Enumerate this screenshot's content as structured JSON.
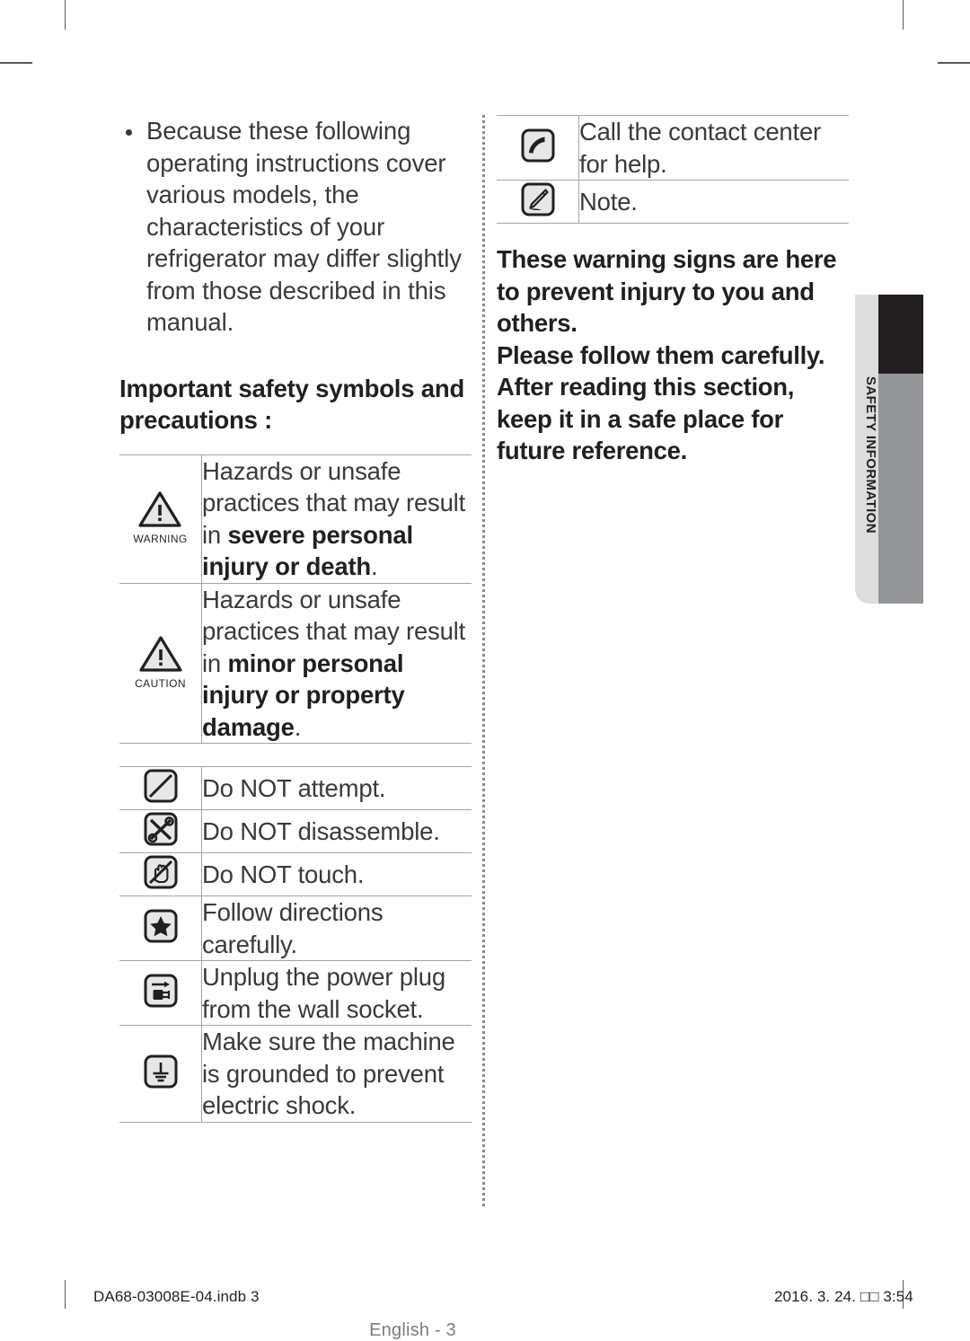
{
  "left_column": {
    "intro_bullets": [
      "Because these following operating instructions cover various models, the characteristics of your refrigerator may differ slightly from those described in this manual."
    ],
    "section_heading": "Important safety symbols and precautions :",
    "severity_table": [
      {
        "icon": "warning-triangle-icon",
        "icon_label": "WARNING",
        "text_plain": "Hazards or unsafe practices that may result in severe personal injury or death.",
        "text_normal": "Hazards or unsafe practices that may result in ",
        "text_bold": "severe personal injury or death",
        "text_tail": "."
      },
      {
        "icon": "caution-triangle-icon",
        "icon_label": "CAUTION",
        "text_plain": "Hazards or unsafe practices that may result in minor personal injury or property damage.",
        "text_normal": "Hazards or unsafe practices that may result in ",
        "text_bold": "minor personal injury or property damage",
        "text_tail": "."
      }
    ],
    "symbol_table": [
      {
        "icon": "do-not-attempt-icon",
        "text": "Do NOT attempt."
      },
      {
        "icon": "do-not-disassemble-icon",
        "text": "Do NOT disassemble."
      },
      {
        "icon": "do-not-touch-icon",
        "text": "Do NOT touch."
      },
      {
        "icon": "follow-directions-icon",
        "text": "Follow directions carefully."
      },
      {
        "icon": "unplug-power-icon",
        "text": "Unplug the power plug from the wall socket."
      },
      {
        "icon": "ground-machine-icon",
        "text": "Make sure the machine is grounded to prevent electric shock."
      }
    ]
  },
  "right_column": {
    "symbol_table": [
      {
        "icon": "phone-call-icon",
        "text": "Call the contact center for help."
      },
      {
        "icon": "note-pen-icon",
        "text": "Note."
      }
    ],
    "notice_lines": [
      "These warning signs are here to prevent injury to you and others.",
      "Please follow them carefully.",
      "After reading this section, keep it in a safe place for future reference."
    ]
  },
  "side_tab": {
    "label": "SAFETY INFORMATION",
    "light_color": "#dddddd",
    "dark_color": "#231f20",
    "gray_color": "#939598"
  },
  "footer": {
    "page_label": "English - 3",
    "print_file": "DA68-03008E-04.indb   3",
    "print_timestamp": "2016. 3. 24.  □□ 3:54"
  }
}
